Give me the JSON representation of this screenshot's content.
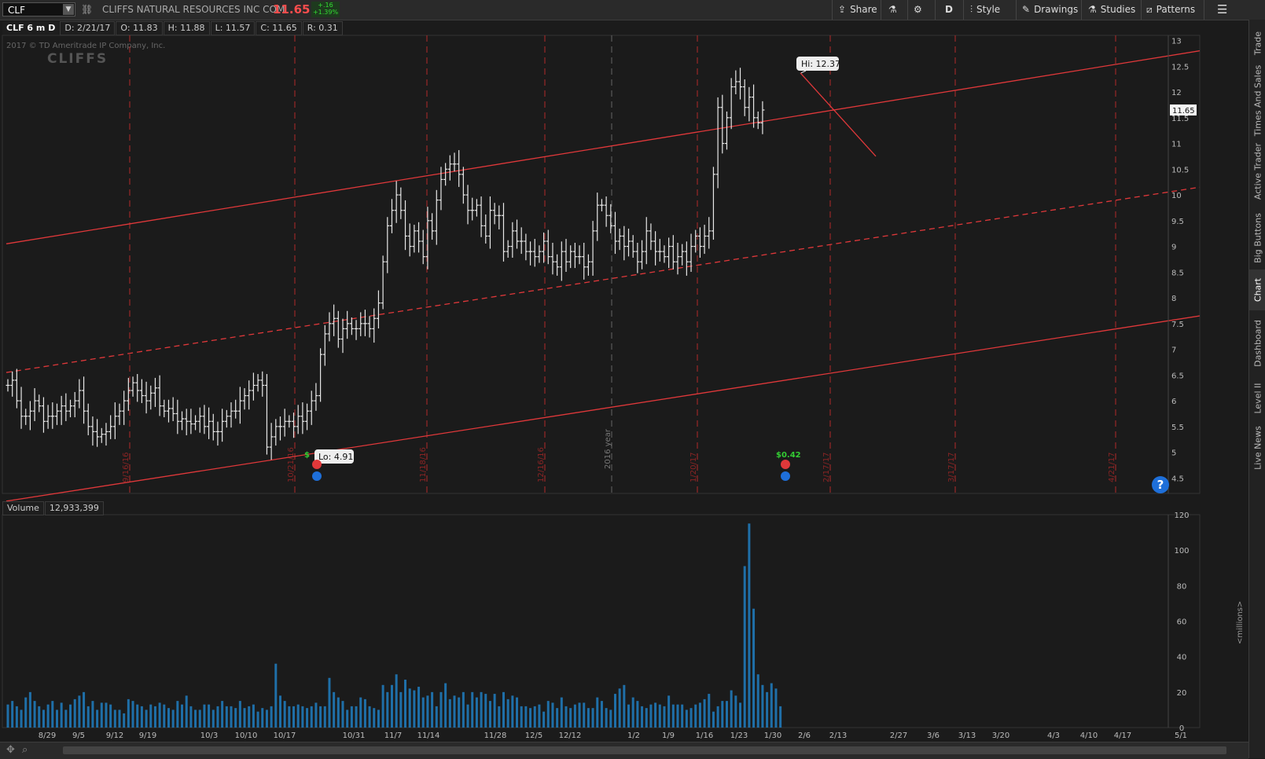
{
  "header": {
    "symbol": "CLF",
    "company": "CLIFFS NATURAL RESOURCES INC COM",
    "last_price": "11.65",
    "change_abs": "+.16",
    "change_pct": "+1.39%",
    "buttons": {
      "share": "Share",
      "period": "D",
      "style": "Style",
      "drawings": "Drawings",
      "studies": "Studies",
      "patterns": "Patterns"
    }
  },
  "info": {
    "chart_label": "CLF 6 m D",
    "date": "D: 2/21/17",
    "open": "O: 11.83",
    "high": "H: 11.88",
    "low": "L: 11.57",
    "close": "C: 11.65",
    "range": "R: 0.31"
  },
  "watermark": {
    "copyright": "2017 © TD Ameritrade IP Company, Inc.",
    "logo": "CLIFFS"
  },
  "volume_panel": {
    "label": "Volume",
    "value": "12,933,399",
    "units": "<millions>"
  },
  "right_tabs": [
    "Trade",
    "Times And Sales",
    "Active Trader",
    "Big Buttons",
    "Chart",
    "Dashboard",
    "Level II",
    "Live News"
  ],
  "colors": {
    "background": "#1b1b1b",
    "bars": "#e8e8e8",
    "channel": "#e0383a",
    "volume": "#1f6fa8",
    "earnings": "#e0383a",
    "dividend": "#33cc33"
  },
  "chart_data": [
    {
      "type": "ohlc",
      "title": "CLF 6 m D",
      "ylim": [
        4.2,
        13.1
      ],
      "y_ticks": [
        "4.5",
        "5",
        "5.5",
        "6",
        "6.5",
        "7",
        "7.5",
        "8",
        "8.5",
        "9",
        "9.5",
        "10",
        "10.5",
        "11",
        "11.5",
        "12",
        "12.5",
        "13"
      ],
      "current_price_label": "11.65",
      "annotations": {
        "high": "Hi: 12.37",
        "low": "Lo: 4.91",
        "dividend": "$0.42",
        "dividend_prefix": "$"
      },
      "vertical_markers": [
        "9/16/16",
        "10/21/16",
        "11/18/16",
        "12/16/16",
        "2016 year",
        "1/20/17",
        "2/17/17",
        "3/17/17",
        "4/21/17"
      ],
      "close_path": [
        6.3,
        6.4,
        6.0,
        5.7,
        5.7,
        5.8,
        6.0,
        5.9,
        5.6,
        5.7,
        5.7,
        5.8,
        5.9,
        5.8,
        5.9,
        6.0,
        6.2,
        5.8,
        5.5,
        5.4,
        5.3,
        5.35,
        5.4,
        5.5,
        5.7,
        5.8,
        6.0,
        6.2,
        6.35,
        6.2,
        6.1,
        6.0,
        6.15,
        6.25,
        5.9,
        5.8,
        5.85,
        5.75,
        5.6,
        5.65,
        5.6,
        5.55,
        5.6,
        5.7,
        5.5,
        5.6,
        5.4,
        5.4,
        5.6,
        5.7,
        5.8,
        5.8,
        6.0,
        6.1,
        6.2,
        6.3,
        6.4,
        6.3,
        5.1,
        5.3,
        5.5,
        5.5,
        5.6,
        5.6,
        5.5,
        5.7,
        5.6,
        5.8,
        6.0,
        6.1,
        6.9,
        7.3,
        7.5,
        7.6,
        7.2,
        7.4,
        7.5,
        7.4,
        7.4,
        7.5,
        7.5,
        7.4,
        7.6,
        7.9,
        8.7,
        9.4,
        9.7,
        10.0,
        9.7,
        9.2,
        9.0,
        9.3,
        9.1,
        8.8,
        9.5,
        9.3,
        9.9,
        10.3,
        10.5,
        10.6,
        10.6,
        10.4,
        10.0,
        9.7,
        9.7,
        9.8,
        9.4,
        9.2,
        9.7,
        9.6,
        9.6,
        8.9,
        9.0,
        9.3,
        9.1,
        9.1,
        8.9,
        8.9,
        8.8,
        8.9,
        9.1,
        8.8,
        8.7,
        8.6,
        8.9,
        8.7,
        8.9,
        8.8,
        8.8,
        8.6,
        8.7,
        9.3,
        9.8,
        9.8,
        9.6,
        9.4,
        9.1,
        9.2,
        9.0,
        9.1,
        8.9,
        8.7,
        8.9,
        9.3,
        9.1,
        8.9,
        8.9,
        8.8,
        9.0,
        8.7,
        8.8,
        8.9,
        8.7,
        9.0,
        9.2,
        9.0,
        9.2,
        9.3,
        10.4,
        11.7,
        11.0,
        11.5,
        12.1,
        12.2,
        12.1,
        11.7,
        11.9,
        11.5,
        11.4,
        11.65
      ],
      "channel": {
        "upper": [
          [
            0,
            9.05
          ],
          [
            1,
            12.8
          ]
        ],
        "middle": [
          [
            0,
            6.55
          ],
          [
            1,
            10.15
          ]
        ],
        "lower": [
          [
            0,
            4.05
          ],
          [
            1,
            7.65
          ]
        ],
        "trendline": [
          [
            12.37,
            10.75
          ]
        ]
      }
    },
    {
      "type": "bar",
      "title": "Volume",
      "ylabel": "<millions>",
      "ylim": [
        0,
        120
      ],
      "y_ticks": [
        "0",
        "20",
        "40",
        "60",
        "80",
        "100",
        "120"
      ],
      "x_ticks": [
        "8/29",
        "9/5",
        "9/12",
        "9/19",
        "10/3",
        "10/10",
        "10/17",
        "10/31",
        "11/7",
        "11/14",
        "11/28",
        "12/5",
        "12/12",
        "1/2",
        "1/9",
        "1/16",
        "1/23",
        "1/30",
        "2/6",
        "2/13",
        "2/27",
        "3/6",
        "3/13",
        "3/20",
        "4/3",
        "4/10",
        "4/17",
        "5/1"
      ],
      "values": [
        13,
        15,
        12,
        10,
        17,
        20,
        15,
        12,
        10,
        13,
        15,
        10,
        14,
        10,
        13,
        16,
        18,
        20,
        12,
        15,
        10,
        14,
        14,
        13,
        10,
        10,
        8,
        16,
        15,
        13,
        12,
        10,
        13,
        12,
        14,
        13,
        11,
        10,
        15,
        13,
        18,
        12,
        10,
        10,
        13,
        13,
        10,
        12,
        15,
        12,
        12,
        11,
        15,
        11,
        12,
        13,
        9,
        11,
        10,
        12,
        36,
        18,
        15,
        12,
        12,
        13,
        12,
        11,
        12,
        14,
        12,
        12,
        28,
        20,
        17,
        15,
        10,
        12,
        12,
        17,
        16,
        12,
        11,
        10,
        24,
        20,
        24,
        30,
        20,
        27,
        22,
        21,
        23,
        17,
        18,
        20,
        12,
        20,
        25,
        16,
        18,
        17,
        20,
        13,
        20,
        17,
        20,
        19,
        15,
        19,
        12,
        20,
        16,
        18,
        17,
        12,
        12,
        11,
        12,
        13,
        9,
        15,
        14,
        11,
        17,
        12,
        11,
        13,
        14,
        14,
        11,
        11,
        17,
        15,
        11,
        10,
        19,
        22,
        24,
        13,
        17,
        15,
        12,
        11,
        13,
        14,
        13,
        12,
        18,
        13,
        13,
        13,
        10,
        11,
        13,
        14,
        16,
        19,
        9,
        12,
        15,
        15,
        21,
        18,
        14,
        91,
        115,
        67,
        30,
        24,
        20,
        25,
        22,
        12
      ]
    }
  ]
}
